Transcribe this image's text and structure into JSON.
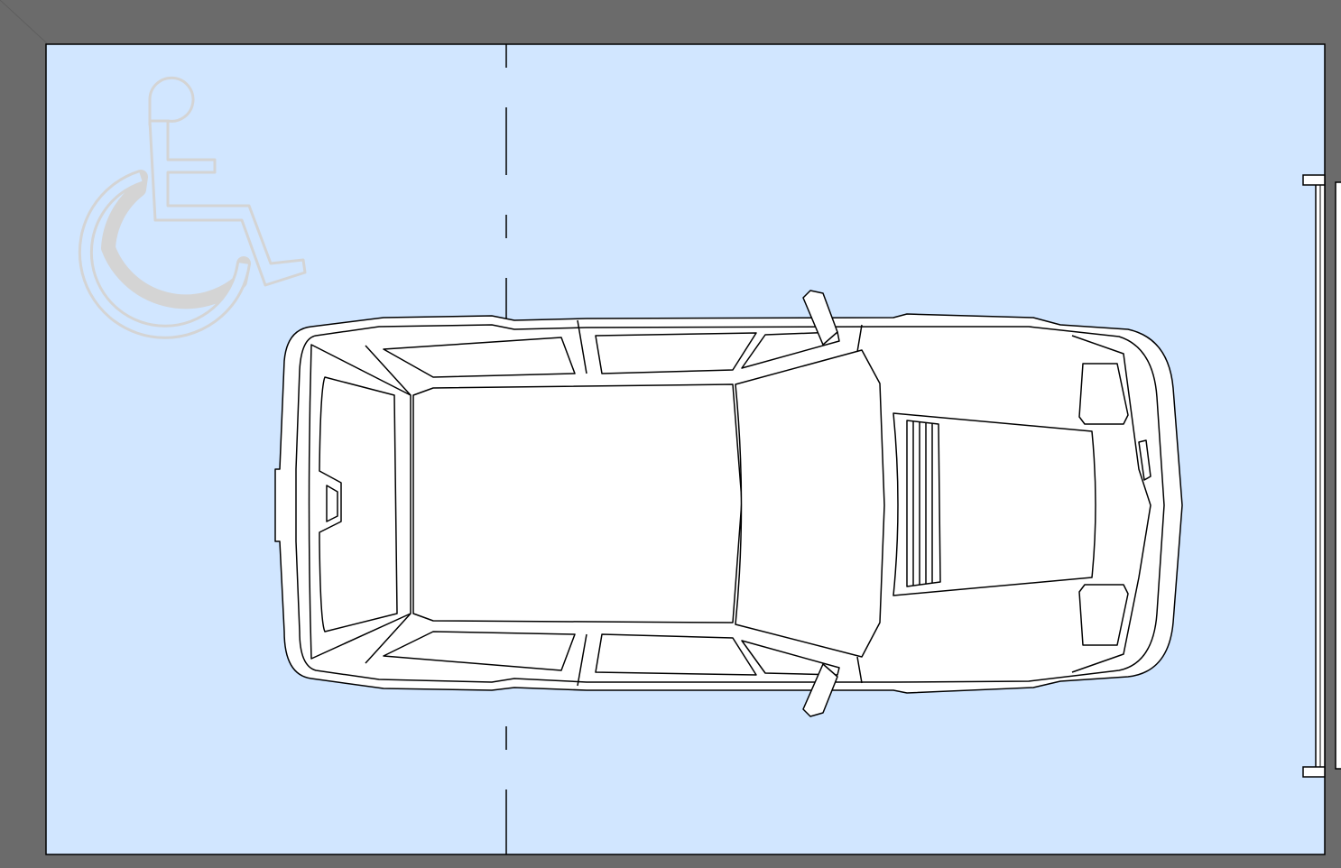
{
  "drawing": {
    "background_color": "#6b6b6b",
    "stall_fill_color": "#d1e6ff",
    "line_color": "#000000",
    "symbol_color": "#d4d4d4",
    "car_fill_color": "#ffffff",
    "symbol": "wheelchair-accessibility-icon",
    "vehicle": "car-top-view",
    "centerline": "dashed-vertical",
    "wheel_stop": "right-edge-barrier"
  }
}
